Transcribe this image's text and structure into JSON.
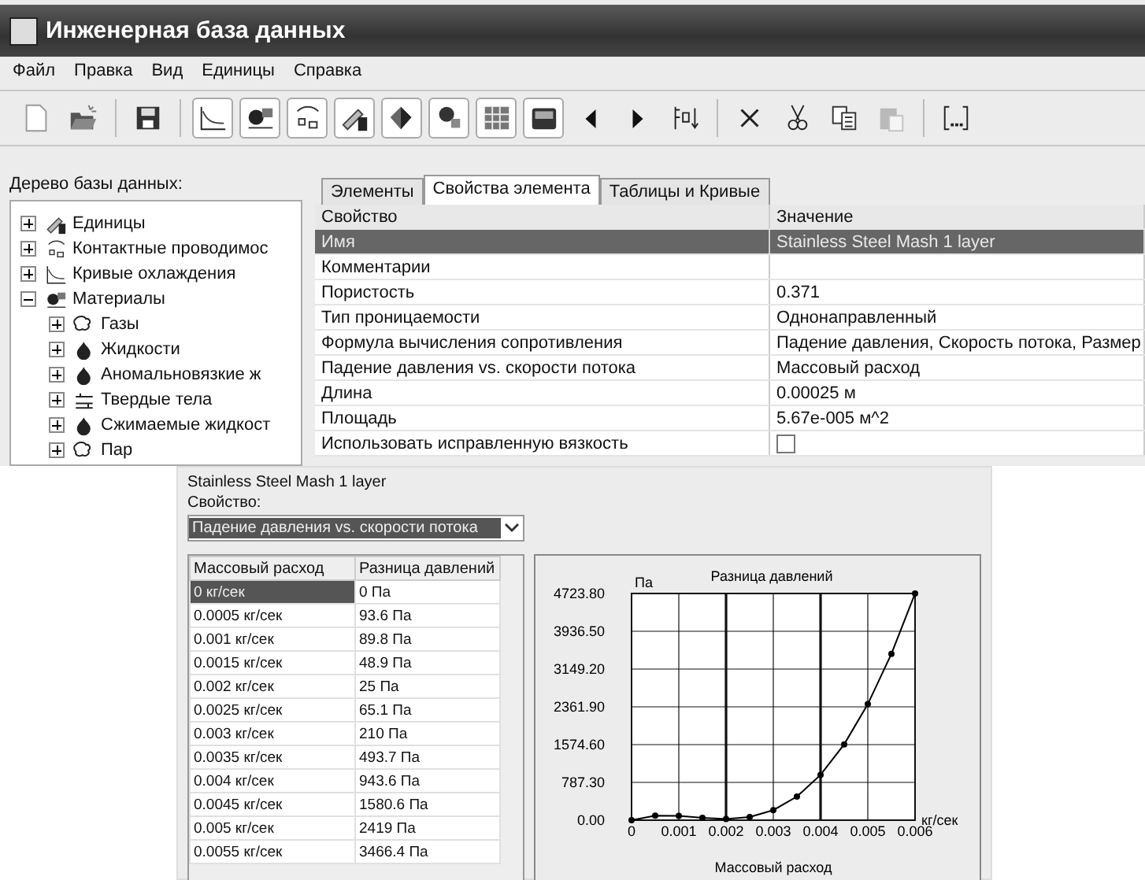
{
  "window": {
    "title": "Инженерная база данных"
  },
  "menu": [
    "Файл",
    "Правка",
    "Вид",
    "Единицы",
    "Справка"
  ],
  "toolbar": [
    {
      "buttons": [
        {
          "kind": "new",
          "disabled": false
        },
        {
          "kind": "open",
          "disabled": false
        }
      ]
    },
    {
      "buttons": [
        {
          "kind": "save",
          "disabled": false
        }
      ]
    },
    {
      "buttons": [
        {
          "kind": "curve",
          "disabled": false
        },
        {
          "kind": "material",
          "disabled": false
        },
        {
          "kind": "contacts",
          "disabled": false
        },
        {
          "kind": "units",
          "disabled": false
        },
        {
          "kind": "fluid",
          "disabled": false
        },
        {
          "kind": "person",
          "disabled": false
        },
        {
          "kind": "table",
          "disabled": false
        },
        {
          "kind": "box",
          "disabled": false
        },
        {
          "kind": "left",
          "disabled": false
        },
        {
          "kind": "right",
          "disabled": false
        },
        {
          "kind": "sort",
          "disabled": false
        }
      ]
    },
    {
      "buttons": [
        {
          "kind": "delete",
          "disabled": false
        },
        {
          "kind": "cut",
          "disabled": false
        },
        {
          "kind": "copy",
          "disabled": false
        },
        {
          "kind": "paste",
          "disabled": true
        }
      ]
    },
    {
      "buttons": [
        {
          "kind": "dots",
          "disabled": false
        }
      ]
    }
  ],
  "tree": {
    "label": "Дерево базы данных:",
    "items": [
      {
        "label": "Единицы",
        "kind": "units",
        "expanded": false
      },
      {
        "label": "Контактные проводимос",
        "kind": "contacts",
        "expanded": false
      },
      {
        "label": "Кривые охлаждения",
        "kind": "curve",
        "expanded": false
      },
      {
        "label": "Материалы",
        "kind": "material",
        "expanded": true,
        "children": [
          {
            "label": "Газы",
            "kind": "gas",
            "expanded": false
          },
          {
            "label": "Жидкости",
            "kind": "liquid",
            "expanded": false
          },
          {
            "label": "Аномальновязкие ж",
            "kind": "liquid",
            "expanded": false
          },
          {
            "label": "Твердые тела",
            "kind": "solid",
            "expanded": false
          },
          {
            "label": "Сжимаемые жидкост",
            "kind": "liquid",
            "expanded": false
          },
          {
            "label": "Пар",
            "kind": "gas",
            "expanded": false
          }
        ]
      }
    ]
  },
  "tabs": [
    {
      "label": "Элементы",
      "selected": false
    },
    {
      "label": "Свойства элемента",
      "selected": true
    },
    {
      "label": "Таблицы и Кривые",
      "selected": false
    }
  ],
  "properties": {
    "columns": [
      "Свойство",
      "Значение"
    ],
    "rows": [
      {
        "kind": "text",
        "property": "Имя",
        "value": "Stainless Steel Mash 1 layer",
        "selected": true
      },
      {
        "kind": "text",
        "property": "Комментарии",
        "selected": false
      },
      {
        "kind": "text",
        "property": "Пористость",
        "value": "0.371",
        "selected": false
      },
      {
        "kind": "text",
        "property": "Тип проницаемости",
        "value": "Однонаправленный",
        "selected": false
      },
      {
        "kind": "text",
        "property": "Формула вычисления сопротивления",
        "value": "Падение давления, Скорость потока, Размер",
        "selected": false
      },
      {
        "kind": "text",
        "property": "Падение давления vs. скорости потока",
        "value": "Массовый расход",
        "selected": false
      },
      {
        "kind": "text",
        "property": "Длина",
        "value": "0.00025 м",
        "selected": false
      },
      {
        "kind": "text",
        "property": "Площадь",
        "value": "5.67e-005 м^2",
        "selected": false
      },
      {
        "kind": "checkbox",
        "property": "Использовать исправленную вязкость",
        "checked": false,
        "selected": false
      }
    ]
  },
  "detail": {
    "title": "Stainless Steel Mash 1 layer",
    "property_label": "Свойство:",
    "property_select": {
      "value": "Падение давления vs. скорости потока"
    },
    "table": {
      "columns": [
        "Массовый расход",
        "Разница давлений"
      ],
      "rows": [
        {
          "cells": [
            "0 кг/сек",
            "0 Па"
          ],
          "selected": true
        },
        {
          "cells": [
            "0.0005 кг/сек",
            "93.6 Па"
          ],
          "selected": false
        },
        {
          "cells": [
            "0.001 кг/сек",
            "89.8 Па"
          ],
          "selected": false
        },
        {
          "cells": [
            "0.0015 кг/сек",
            "48.9 Па"
          ],
          "selected": false
        },
        {
          "cells": [
            "0.002 кг/сек",
            "25 Па"
          ],
          "selected": false
        },
        {
          "cells": [
            "0.0025 кг/сек",
            "65.1 Па"
          ],
          "selected": false
        },
        {
          "cells": [
            "0.003 кг/сек",
            "210 Па"
          ],
          "selected": false
        },
        {
          "cells": [
            "0.0035 кг/сек",
            "493.7 Па"
          ],
          "selected": false
        },
        {
          "cells": [
            "0.004 кг/сек",
            "943.6 Па"
          ],
          "selected": false
        },
        {
          "cells": [
            "0.0045 кг/сек",
            "1580.6 Па"
          ],
          "selected": false
        },
        {
          "cells": [
            "0.005 кг/сек",
            "2419 Па"
          ],
          "selected": false
        },
        {
          "cells": [
            "0.0055 кг/сек",
            "3466.4 Па"
          ],
          "selected": false
        }
      ]
    },
    "chart": {
      "x_unit": "кг/сек",
      "chart_data": {
        "type": "line",
        "xlabel": "Массовый расход",
        "ylabel": "Па",
        "x": [
          0,
          0.0005,
          0.001,
          0.0015,
          0.002,
          0.0025,
          0.003,
          0.0035,
          0.004,
          0.0045,
          0.005,
          0.0055,
          0.006
        ],
        "grid": true,
        "series": [
          {
            "name": "Разница давлений",
            "color": "#000000",
            "marker": "circle",
            "values": [
              0,
              93.6,
              89.8,
              48.9,
              25,
              65.1,
              210,
              493.7,
              943.6,
              1580.6,
              2419,
              3466.4,
              4723.8
            ]
          }
        ],
        "xlim": [
          0,
          0.006
        ],
        "ylim": [
          0,
          4723.8
        ],
        "xticks": [
          {
            "value": 0,
            "label": "0"
          },
          {
            "value": 0.001,
            "label": "0.001"
          },
          {
            "value": 0.002,
            "label": "0.002"
          },
          {
            "value": 0.003,
            "label": "0.003"
          },
          {
            "value": 0.004,
            "label": "0.004"
          },
          {
            "value": 0.005,
            "label": "0.005"
          },
          {
            "value": 0.006,
            "label": "0.006"
          }
        ],
        "yticks": [
          {
            "value": 0,
            "label": "0.00"
          },
          {
            "value": 787.3,
            "label": "787.30"
          },
          {
            "value": 1574.6,
            "label": "1574.60"
          },
          {
            "value": 2361.9,
            "label": "2361.90"
          },
          {
            "value": 3149.2,
            "label": "3149.20"
          },
          {
            "value": 3936.5,
            "label": "3936.50"
          },
          {
            "value": 4723.8,
            "label": "4723.80"
          }
        ]
      }
    }
  }
}
